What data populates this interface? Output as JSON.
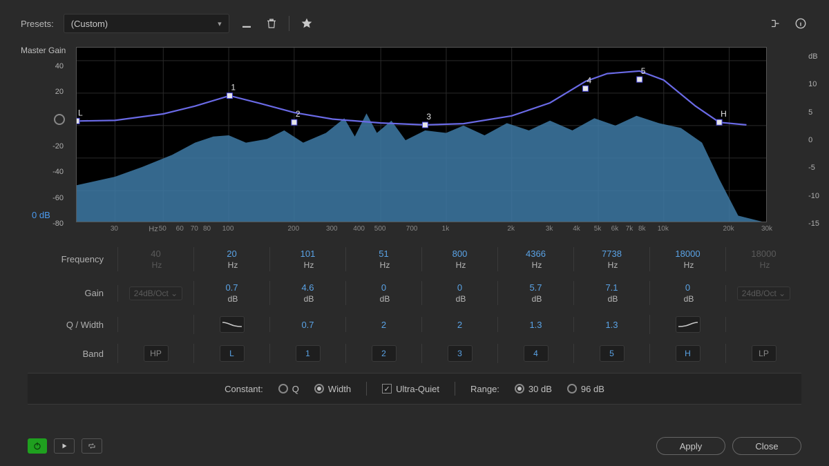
{
  "toolbar": {
    "presets_label": "Presets:",
    "preset_value": "(Custom)"
  },
  "master_gain_label": "Master Gain",
  "master_gain_value": "0 dB",
  "y_left_ticks": [
    "40",
    "20",
    "0",
    "-20",
    "-40",
    "-60",
    "-80"
  ],
  "y_right_unit": "dB",
  "y_right_ticks": [
    "10",
    "5",
    "0",
    "-5",
    "-10",
    "-15"
  ],
  "x_units": "Hz",
  "x_ticks": [
    {
      "v": "30",
      "f": 30
    },
    {
      "v": "50",
      "f": 50
    },
    {
      "v": "60",
      "f": 60
    },
    {
      "v": "70",
      "f": 70
    },
    {
      "v": "80",
      "f": 80
    },
    {
      "v": "100",
      "f": 100
    },
    {
      "v": "200",
      "f": 200
    },
    {
      "v": "300",
      "f": 300
    },
    {
      "v": "400",
      "f": 400
    },
    {
      "v": "500",
      "f": 500
    },
    {
      "v": "700",
      "f": 700
    },
    {
      "v": "1k",
      "f": 1000
    },
    {
      "v": "2k",
      "f": 2000
    },
    {
      "v": "3k",
      "f": 3000
    },
    {
      "v": "4k",
      "f": 4000
    },
    {
      "v": "5k",
      "f": 5000
    },
    {
      "v": "6k",
      "f": 6000
    },
    {
      "v": "7k",
      "f": 7000
    },
    {
      "v": "8k",
      "f": 8000
    },
    {
      "v": "10k",
      "f": 10000
    },
    {
      "v": "20k",
      "f": 20000
    },
    {
      "v": "30k",
      "f": 30000
    }
  ],
  "rows": {
    "frequency": "Frequency",
    "gain": "Gain",
    "qwidth": "Q / Width",
    "band": "Band"
  },
  "bands": [
    {
      "id": "hp",
      "label": "HP",
      "freq": "40",
      "freq_unit": "Hz",
      "gain": "",
      "gain_unit": "",
      "slope": "24dB/Oct",
      "disabled": true
    },
    {
      "id": "L",
      "label": "L",
      "freq": "20",
      "freq_unit": "Hz",
      "gain": "0.7",
      "gain_unit": "dB",
      "q": "",
      "shape": "low-shelf"
    },
    {
      "id": "1",
      "label": "1",
      "freq": "101",
      "freq_unit": "Hz",
      "gain": "4.6",
      "gain_unit": "dB",
      "q": "0.7"
    },
    {
      "id": "2",
      "label": "2",
      "freq": "51",
      "freq_unit": "Hz",
      "gain": "0",
      "gain_unit": "dB",
      "q": "2"
    },
    {
      "id": "3",
      "label": "3",
      "freq": "800",
      "freq_unit": "Hz",
      "gain": "0",
      "gain_unit": "dB",
      "q": "2"
    },
    {
      "id": "4",
      "label": "4",
      "freq": "4366",
      "freq_unit": "Hz",
      "gain": "5.7",
      "gain_unit": "dB",
      "q": "1.3"
    },
    {
      "id": "5",
      "label": "5",
      "freq": "7738",
      "freq_unit": "Hz",
      "gain": "7.1",
      "gain_unit": "dB",
      "q": "1.3"
    },
    {
      "id": "H",
      "label": "H",
      "freq": "18000",
      "freq_unit": "Hz",
      "gain": "0",
      "gain_unit": "dB",
      "q": "",
      "shape": "high-shelf"
    },
    {
      "id": "lp",
      "label": "LP",
      "freq": "18000",
      "freq_unit": "Hz",
      "gain": "",
      "gain_unit": "",
      "slope": "24dB/Oct",
      "disabled": true
    }
  ],
  "options": {
    "constant_label": "Constant:",
    "q": "Q",
    "width": "Width",
    "ultra_quiet": "Ultra-Quiet",
    "range_label": "Range:",
    "r30": "30 dB",
    "r96": "96 dB",
    "constant_value": "width",
    "ultra_quiet_checked": true,
    "range_value": "30"
  },
  "buttons": {
    "apply": "Apply",
    "close": "Close"
  },
  "chart_data": {
    "type": "line",
    "title": "",
    "x_scale": "log",
    "x_range_hz": [
      20,
      30000
    ],
    "y_left_range_db": [
      -96,
      48
    ],
    "y_right_range_db": [
      -15,
      12
    ],
    "eq_curve_points_db": [
      {
        "hz": 20,
        "db": 0.7
      },
      {
        "hz": 30,
        "db": 0.8
      },
      {
        "hz": 50,
        "db": 1.8
      },
      {
        "hz": 70,
        "db": 3.0
      },
      {
        "hz": 101,
        "db": 4.6
      },
      {
        "hz": 140,
        "db": 3.4
      },
      {
        "hz": 200,
        "db": 2.0
      },
      {
        "hz": 300,
        "db": 1.0
      },
      {
        "hz": 500,
        "db": 0.4
      },
      {
        "hz": 800,
        "db": 0.1
      },
      {
        "hz": 1200,
        "db": 0.3
      },
      {
        "hz": 2000,
        "db": 1.5
      },
      {
        "hz": 3000,
        "db": 3.5
      },
      {
        "hz": 4366,
        "db": 6.8
      },
      {
        "hz": 5500,
        "db": 8.0
      },
      {
        "hz": 7738,
        "db": 8.4
      },
      {
        "hz": 10000,
        "db": 7.0
      },
      {
        "hz": 14000,
        "db": 3.0
      },
      {
        "hz": 18000,
        "db": 0.5
      },
      {
        "hz": 24000,
        "db": 0.1
      }
    ],
    "spectrum_approx_db": [
      {
        "hz": 20,
        "db": -65
      },
      {
        "hz": 30,
        "db": -58
      },
      {
        "hz": 40,
        "db": -50
      },
      {
        "hz": 55,
        "db": -40
      },
      {
        "hz": 70,
        "db": -30
      },
      {
        "hz": 85,
        "db": -25
      },
      {
        "hz": 100,
        "db": -24
      },
      {
        "hz": 120,
        "db": -30
      },
      {
        "hz": 150,
        "db": -27
      },
      {
        "hz": 180,
        "db": -20
      },
      {
        "hz": 220,
        "db": -30
      },
      {
        "hz": 280,
        "db": -22
      },
      {
        "hz": 340,
        "db": -10
      },
      {
        "hz": 380,
        "db": -25
      },
      {
        "hz": 430,
        "db": -6
      },
      {
        "hz": 480,
        "db": -22
      },
      {
        "hz": 560,
        "db": -12
      },
      {
        "hz": 650,
        "db": -28
      },
      {
        "hz": 800,
        "db": -20
      },
      {
        "hz": 1000,
        "db": -22
      },
      {
        "hz": 1200,
        "db": -16
      },
      {
        "hz": 1500,
        "db": -24
      },
      {
        "hz": 1900,
        "db": -14
      },
      {
        "hz": 2400,
        "db": -20
      },
      {
        "hz": 3000,
        "db": -12
      },
      {
        "hz": 3800,
        "db": -20
      },
      {
        "hz": 4800,
        "db": -10
      },
      {
        "hz": 6000,
        "db": -16
      },
      {
        "hz": 7500,
        "db": -8
      },
      {
        "hz": 9500,
        "db": -14
      },
      {
        "hz": 12000,
        "db": -18
      },
      {
        "hz": 15000,
        "db": -30
      },
      {
        "hz": 18000,
        "db": -60
      },
      {
        "hz": 22000,
        "db": -90
      }
    ],
    "band_markers": [
      {
        "id": "L",
        "hz": 20,
        "db": 0.7
      },
      {
        "id": "1",
        "hz": 101,
        "db": 4.6
      },
      {
        "id": "2",
        "hz": 200,
        "db": 0.5
      },
      {
        "id": "3",
        "hz": 800,
        "db": 0.1
      },
      {
        "id": "4",
        "hz": 4366,
        "db": 5.7
      },
      {
        "id": "5",
        "hz": 7738,
        "db": 7.1
      },
      {
        "id": "H",
        "hz": 18000,
        "db": 0.5
      }
    ]
  }
}
